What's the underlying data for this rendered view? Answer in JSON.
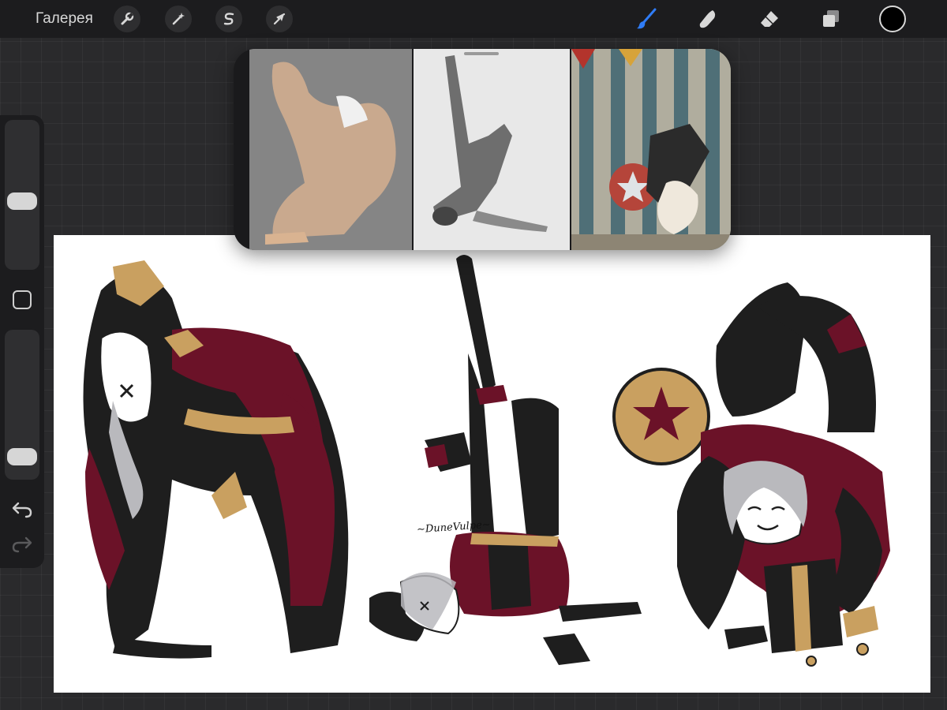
{
  "toolbar": {
    "gallery_label": "Галерея",
    "actions_icon": "wrench-icon",
    "adjustments_icon": "magic-wand-icon",
    "selection_icon": "selection-s-icon",
    "transform_icon": "arrow-cursor-icon",
    "brush_icon": "brush-icon",
    "smudge_icon": "smudge-finger-icon",
    "eraser_icon": "eraser-icon",
    "layers_icon": "layers-icon",
    "active_color": "#000000",
    "accent_color": "#2f7cf6"
  },
  "sidebar": {
    "brush_size_level": 0.45,
    "opacity_level": 0.08,
    "modify_icon": "square-icon",
    "undo_icon": "undo-icon",
    "redo_icon": "redo-icon"
  },
  "canvas": {
    "signature": "~DuneVulpe~",
    "background": "#ffffff",
    "palette": {
      "wine": "#6b1228",
      "gold": "#c9a060",
      "black": "#1e1e1e",
      "hair": "#b9b9bd"
    }
  },
  "reference": {
    "photos": [
      {
        "subject": "dancer-backbend-photo"
      },
      {
        "subject": "dancer-shoulder-stand-photo"
      },
      {
        "subject": "circus-performer-photo"
      }
    ]
  }
}
